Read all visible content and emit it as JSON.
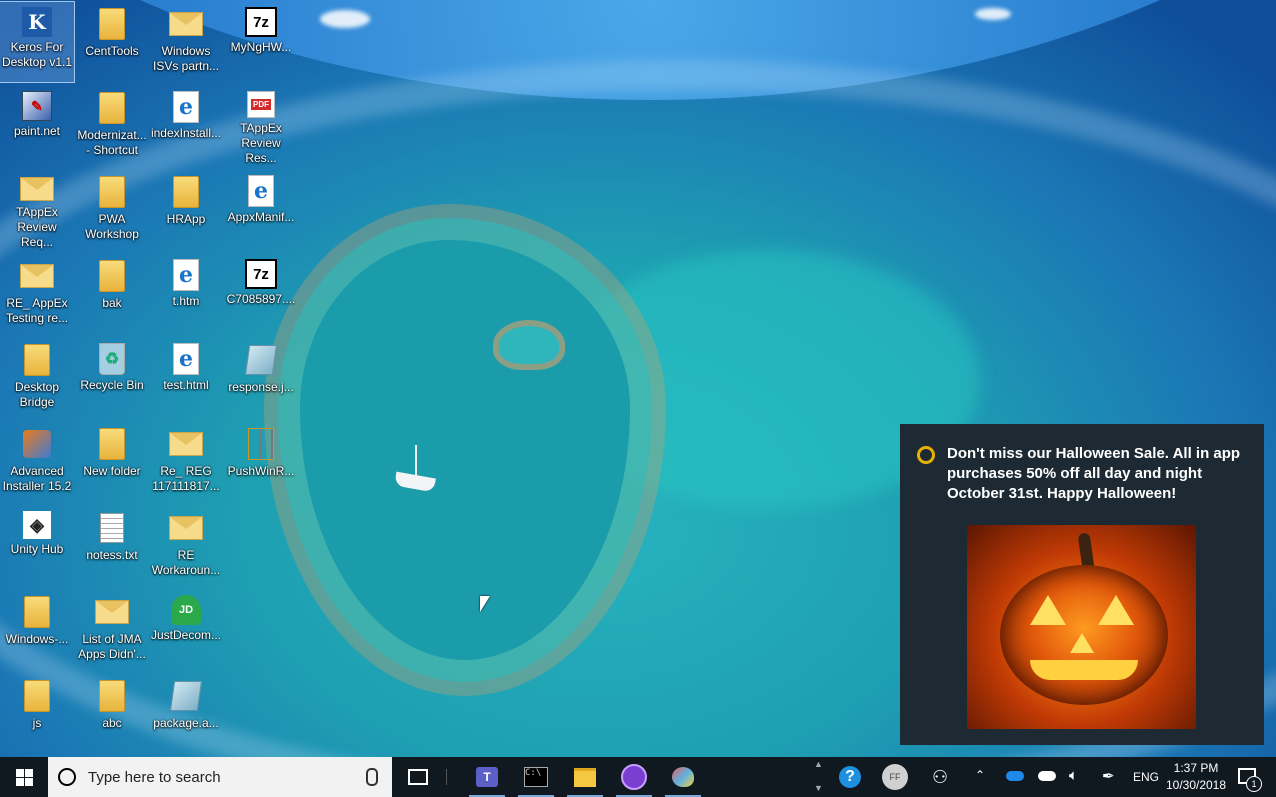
{
  "desktop": {
    "icons": [
      {
        "label": "Keros For\nDesktop v1.1",
        "icon": "keros-app-icon",
        "glyph": "K"
      },
      {
        "label": "paint.net",
        "icon": "paintnet-icon",
        "glyph": "✎"
      },
      {
        "label": "TAppEx\nReview Req...",
        "icon": "mail-icon",
        "glyph": ""
      },
      {
        "label": "RE_ AppEx\nTesting re...",
        "icon": "mail-icon",
        "glyph": ""
      },
      {
        "label": "Desktop\nBridge",
        "icon": "folder-icon",
        "glyph": ""
      },
      {
        "label": "Advanced\nInstaller 15.2",
        "icon": "advanced-installer-icon",
        "glyph": ""
      },
      {
        "label": "Unity Hub",
        "icon": "unity-icon",
        "glyph": "◈"
      },
      {
        "label": "Windows-...",
        "icon": "folder-icon",
        "glyph": ""
      },
      {
        "label": "js",
        "icon": "folder-icon",
        "glyph": ""
      },
      {
        "label": "CentTools",
        "icon": "folder-icon",
        "glyph": ""
      },
      {
        "label": "Modernizat...\n- Shortcut",
        "icon": "folder-shortcut-icon",
        "glyph": ""
      },
      {
        "label": "PWA\nWorkshop",
        "icon": "folder-icon",
        "glyph": ""
      },
      {
        "label": "bak",
        "icon": "folder-icon",
        "glyph": ""
      },
      {
        "label": "Recycle Bin",
        "icon": "recycle-bin-icon",
        "glyph": "♻"
      },
      {
        "label": "New folder",
        "icon": "folder-icon",
        "glyph": ""
      },
      {
        "label": "notess.txt",
        "icon": "text-file-icon",
        "glyph": ""
      },
      {
        "label": "List of JMA\nApps Didn'...",
        "icon": "mail-icon",
        "glyph": ""
      },
      {
        "label": "abc",
        "icon": "folder-icon",
        "glyph": ""
      },
      {
        "label": "Windows\nISVs partn...",
        "icon": "mail-icon",
        "glyph": ""
      },
      {
        "label": "indexInstall...",
        "icon": "edge-html-icon",
        "glyph": "e"
      },
      {
        "label": "HRApp",
        "icon": "folder-icon",
        "glyph": ""
      },
      {
        "label": "t.htm",
        "icon": "edge-html-icon",
        "glyph": "e"
      },
      {
        "label": "test.html",
        "icon": "edge-html-icon",
        "glyph": "e"
      },
      {
        "label": "Re_ REG\n117111817...",
        "icon": "mail-icon",
        "glyph": ""
      },
      {
        "label": "RE\nWorkaroun...",
        "icon": "mail-icon",
        "glyph": ""
      },
      {
        "label": "JustDecom...",
        "icon": "justdecompile-icon",
        "glyph": "JD"
      },
      {
        "label": "package.a...",
        "icon": "json-file-icon",
        "glyph": ""
      },
      {
        "label": "MyNgHW...",
        "icon": "7zip-icon",
        "glyph": "7z"
      },
      {
        "label": "TAppEx\nReview Res...",
        "icon": "pdf-icon",
        "glyph": "PDF"
      },
      {
        "label": "AppxManif...",
        "icon": "edge-html-icon",
        "glyph": "e"
      },
      {
        "label": "C7085897....",
        "icon": "7zip-icon",
        "glyph": "7z"
      },
      {
        "label": "response.j...",
        "icon": "json-file-icon",
        "glyph": ""
      },
      {
        "label": "PushWinR...",
        "icon": "zip-folder-icon",
        "glyph": ""
      }
    ]
  },
  "toast": {
    "message": "Don't miss our Halloween Sale. All in app purchases 50% off all day and night October 31st. Happy Halloween!",
    "image": "jack-o-lantern-image"
  },
  "taskbar": {
    "search_placeholder": "Type here to search",
    "pinned": [
      {
        "name": "teams",
        "glyph": "T"
      },
      {
        "name": "command-prompt",
        "glyph": "C:\\"
      },
      {
        "name": "file-explorer",
        "glyph": ""
      },
      {
        "name": "clock-app",
        "glyph": ""
      },
      {
        "name": "paint",
        "glyph": ""
      }
    ],
    "help_glyph": "?",
    "avatar_initials": "FF",
    "language": "ENG",
    "time": "1:37 PM",
    "date": "10/30/2018",
    "notification_count": "1"
  },
  "colors": {
    "taskbar": "#101820",
    "toast_bg": "#1d2a33",
    "accent": "#1e8ae8"
  }
}
